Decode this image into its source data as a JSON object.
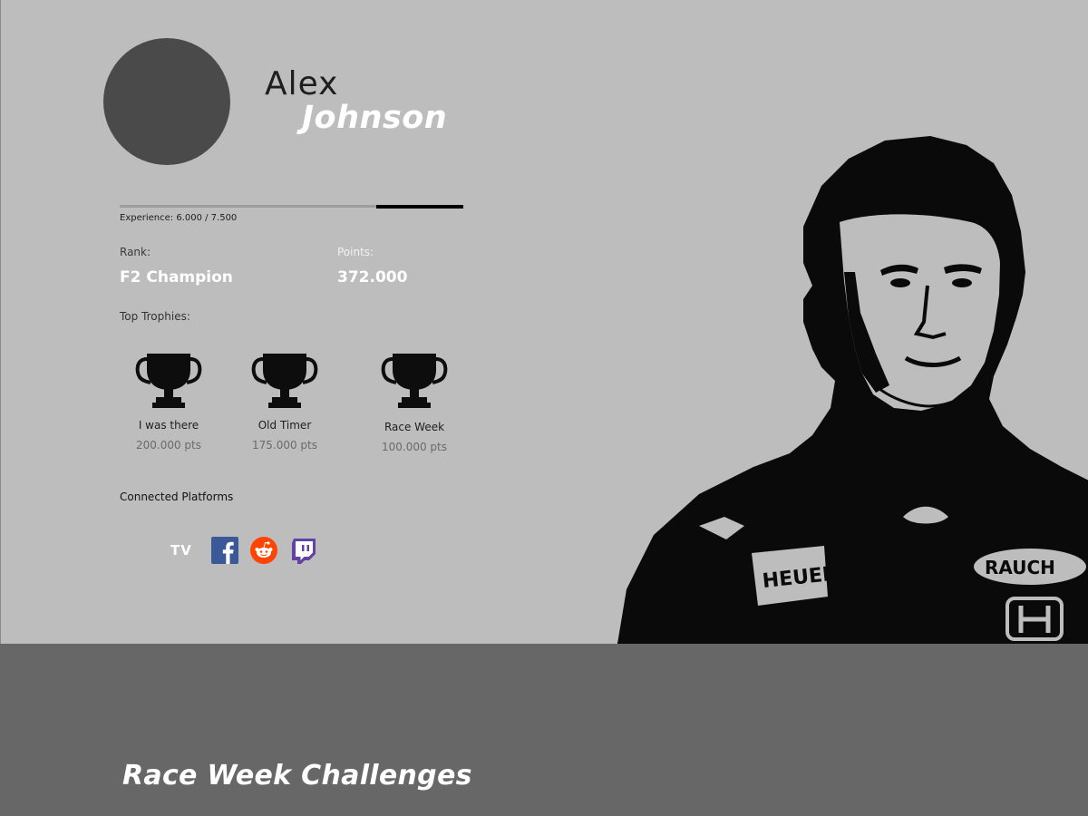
{
  "profile": {
    "first_name": "Alex",
    "last_name": "Johnson",
    "experience": {
      "label": "Experience: 6.000 / 7.500",
      "current": 6000,
      "max": 7500
    },
    "rank": {
      "label": "Rank:",
      "value": "F2 Champion"
    },
    "points": {
      "label": "Points:",
      "value": "372.000"
    }
  },
  "trophies": {
    "label": "Top Trophies:",
    "items": [
      {
        "name": "I was there",
        "points": "200.000 pts",
        "icon": "trophy-icon"
      },
      {
        "name": "Old Timer",
        "points": "175.000 pts",
        "icon": "trophy-icon"
      },
      {
        "name": "Race Week",
        "points": "100.000 pts",
        "icon": "trophy-icon"
      }
    ]
  },
  "platforms": {
    "label": "Connected Platforms",
    "items": [
      {
        "name": "TV",
        "icon": "tv-icon",
        "color": "#ffffff"
      },
      {
        "name": "Facebook",
        "icon": "facebook-icon",
        "color": "#3b5998"
      },
      {
        "name": "Reddit",
        "icon": "reddit-icon",
        "color": "#ff4500"
      },
      {
        "name": "Twitch",
        "icon": "twitch-icon",
        "color": "#6441a5"
      }
    ]
  },
  "driver_image": {
    "sponsor_texts": [
      "RAUCH",
      "HEUER"
    ]
  },
  "section": {
    "title": "Race Week Challenges"
  },
  "colors": {
    "background": "#bdbdbd",
    "band": "#676767",
    "avatar": "#4a4a4a"
  }
}
